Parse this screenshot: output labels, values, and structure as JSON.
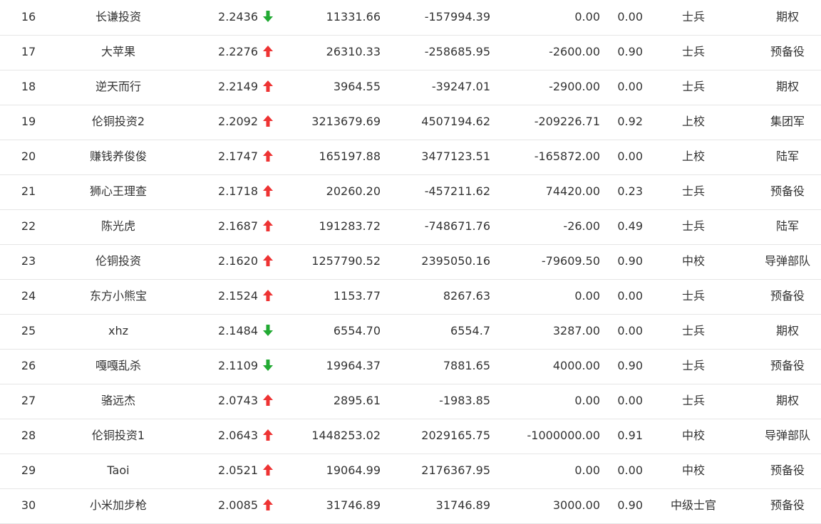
{
  "colors": {
    "up": "#ee3333",
    "down": "#22aa33"
  },
  "rows": [
    {
      "rank": "16",
      "name": "长谦投资",
      "score": "2.2436",
      "trend": "down",
      "v1": "11331.66",
      "v2": "-157994.39",
      "v3": "0.00",
      "v4": "0.00",
      "level": "士兵",
      "unit": "期权"
    },
    {
      "rank": "17",
      "name": "大苹果",
      "score": "2.2276",
      "trend": "up",
      "v1": "26310.33",
      "v2": "-258685.95",
      "v3": "-2600.00",
      "v4": "0.90",
      "level": "士兵",
      "unit": "预备役"
    },
    {
      "rank": "18",
      "name": "逆天而行",
      "score": "2.2149",
      "trend": "up",
      "v1": "3964.55",
      "v2": "-39247.01",
      "v3": "-2900.00",
      "v4": "0.00",
      "level": "士兵",
      "unit": "期权"
    },
    {
      "rank": "19",
      "name": "伦铜投资2",
      "score": "2.2092",
      "trend": "up",
      "v1": "3213679.69",
      "v2": "4507194.62",
      "v3": "-209226.71",
      "v4": "0.92",
      "level": "上校",
      "unit": "集团军"
    },
    {
      "rank": "20",
      "name": "赚钱养俊俊",
      "score": "2.1747",
      "trend": "up",
      "v1": "165197.88",
      "v2": "3477123.51",
      "v3": "-165872.00",
      "v4": "0.00",
      "level": "上校",
      "unit": "陆军"
    },
    {
      "rank": "21",
      "name": "狮心王理查",
      "score": "2.1718",
      "trend": "up",
      "v1": "20260.20",
      "v2": "-457211.62",
      "v3": "74420.00",
      "v4": "0.23",
      "level": "士兵",
      "unit": "预备役"
    },
    {
      "rank": "22",
      "name": "陈光虎",
      "score": "2.1687",
      "trend": "up",
      "v1": "191283.72",
      "v2": "-748671.76",
      "v3": "-26.00",
      "v4": "0.49",
      "level": "士兵",
      "unit": "陆军"
    },
    {
      "rank": "23",
      "name": "伦铜投资",
      "score": "2.1620",
      "trend": "up",
      "v1": "1257790.52",
      "v2": "2395050.16",
      "v3": "-79609.50",
      "v4": "0.90",
      "level": "中校",
      "unit": "导弹部队"
    },
    {
      "rank": "24",
      "name": "东方小熊宝",
      "score": "2.1524",
      "trend": "up",
      "v1": "1153.77",
      "v2": "8267.63",
      "v3": "0.00",
      "v4": "0.00",
      "level": "士兵",
      "unit": "预备役"
    },
    {
      "rank": "25",
      "name": "xhz",
      "score": "2.1484",
      "trend": "down",
      "v1": "6554.70",
      "v2": "6554.7",
      "v3": "3287.00",
      "v4": "0.00",
      "level": "士兵",
      "unit": "期权"
    },
    {
      "rank": "26",
      "name": "嘎嘎乱杀",
      "score": "2.1109",
      "trend": "down",
      "v1": "19964.37",
      "v2": "7881.65",
      "v3": "4000.00",
      "v4": "0.90",
      "level": "士兵",
      "unit": "预备役"
    },
    {
      "rank": "27",
      "name": "骆远杰",
      "score": "2.0743",
      "trend": "up",
      "v1": "2895.61",
      "v2": "-1983.85",
      "v3": "0.00",
      "v4": "0.00",
      "level": "士兵",
      "unit": "期权"
    },
    {
      "rank": "28",
      "name": "伦铜投资1",
      "score": "2.0643",
      "trend": "up",
      "v1": "1448253.02",
      "v2": "2029165.75",
      "v3": "-1000000.00",
      "v4": "0.91",
      "level": "中校",
      "unit": "导弹部队"
    },
    {
      "rank": "29",
      "name": "Taoi",
      "score": "2.0521",
      "trend": "up",
      "v1": "19064.99",
      "v2": "2176367.95",
      "v3": "0.00",
      "v4": "0.00",
      "level": "中校",
      "unit": "预备役"
    },
    {
      "rank": "30",
      "name": "小米加步枪",
      "score": "2.0085",
      "trend": "up",
      "v1": "31746.89",
      "v2": "31746.89",
      "v3": "3000.00",
      "v4": "0.90",
      "level": "中级士官",
      "unit": "预备役"
    }
  ]
}
